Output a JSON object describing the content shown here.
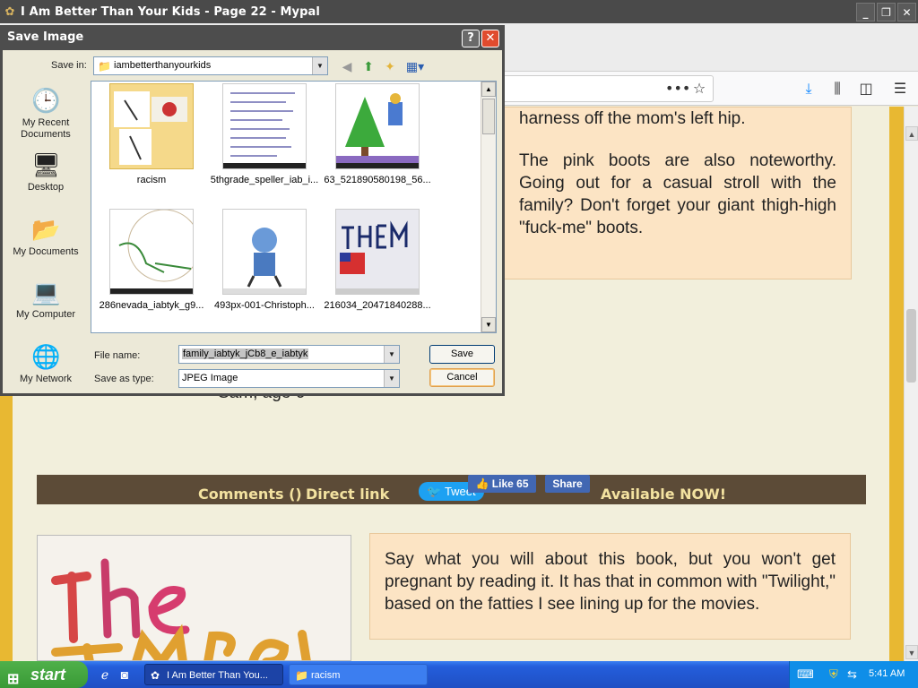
{
  "browser": {
    "title": "I Am Better Than Your Kids - Page 22 - Mypal",
    "nav_icons": [
      "more-icon",
      "bookmark-star-icon",
      "download-icon",
      "library-icon",
      "sidebar-icon",
      "menu-icon"
    ]
  },
  "page": {
    "top_bubble": {
      "line1": "harness off the mom's left hip.",
      "para2": "The pink boots are also noteworthy. Going out for a casual stroll with the family? Don't forget your giant thigh-high \"fuck-me\" boots."
    },
    "caption": "Sam, age 6",
    "comment_bar": {
      "comments": "Comments ()",
      "direct_link": "Direct link",
      "tweet": "Tweet",
      "like": "Like 65",
      "share": "Share",
      "available": "Available NOW!"
    },
    "bottom_bubble": "Say what you will about this book, but you won't get pregnant by reading it. It has that in common with \"Twilight,\" based on the fatties I see lining up for the movies.",
    "colors": {
      "page_border": "#e8b832",
      "page_bg": "#f2efdc",
      "bubble_bg": "#fce4c4",
      "comment_bar": "#5c4b37"
    }
  },
  "dialog": {
    "title": "Save Image",
    "help": "?",
    "close": "✕",
    "save_in_label": "Save in:",
    "save_in_value": "iambetterthanyourkids",
    "places": [
      {
        "label": "My Recent Documents",
        "icon": "recent-documents-icon"
      },
      {
        "label": "Desktop",
        "icon": "desktop-icon"
      },
      {
        "label": "My Documents",
        "icon": "my-documents-icon"
      },
      {
        "label": "My Computer",
        "icon": "my-computer-icon"
      },
      {
        "label": "My Network",
        "icon": "my-network-icon"
      }
    ],
    "files": [
      {
        "name": "racism"
      },
      {
        "name": "5thgrade_speller_iab_i..."
      },
      {
        "name": "63_521890580198_56..."
      },
      {
        "name": "286nevada_iabtyk_g9..."
      },
      {
        "name": "493px-001-Christoph..."
      },
      {
        "name": "216034_20471840288..."
      }
    ],
    "file_name_label": "File name:",
    "file_name_value": "family_iabtyk_jCb8_e_iabtyk",
    "save_type_label": "Save as type:",
    "save_type_value": "JPEG Image",
    "save_button": "Save",
    "cancel_button": "Cancel"
  },
  "taskbar": {
    "start": "start",
    "tasks": [
      {
        "label": "I Am Better Than You..."
      },
      {
        "label": "racism"
      }
    ],
    "clock": "5:41 AM"
  }
}
